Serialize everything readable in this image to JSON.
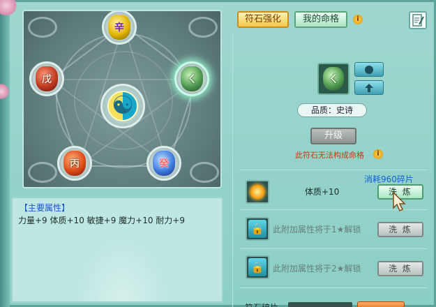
{
  "colors": {
    "accent_tab": "#f2c94c",
    "attr_title": "#1a55c8",
    "warning": "#d0360e",
    "cost": "#1260d6"
  },
  "star_map": {
    "nodes": [
      {
        "key": "top",
        "glyph": "辛",
        "icon": "xin-rune-gem"
      },
      {
        "key": "left",
        "glyph": "戊",
        "icon": "wu-rune-gem"
      },
      {
        "key": "right",
        "glyph": "ㄑ",
        "icon": "green-rune-gem",
        "selected": true
      },
      {
        "key": "bottom_left",
        "glyph": "丙",
        "icon": "bing-rune-gem"
      },
      {
        "key": "bottom_right",
        "glyph": "癸",
        "icon": "gui-rune-gem"
      }
    ],
    "center_icon": "yin-yang-icon"
  },
  "attributes": {
    "title": "【主要属性】",
    "values": "力量+9 体质+10 敏捷+9 魔力+10 耐力+9"
  },
  "tabs": [
    {
      "label": "符石强化",
      "active": true
    },
    {
      "label": "我的命格",
      "active": false
    }
  ],
  "detail": {
    "quality_label": "品质：史诗",
    "upgrade_label": "升级",
    "warning_text": "此符石无法构成命格",
    "cost_text": "消耗960碎片"
  },
  "refine_rows": [
    {
      "text": "体质+10",
      "button": "洗 炼",
      "locked": false
    },
    {
      "text": "此附加属性将于1★解锁",
      "button": "洗 炼",
      "locked": true
    },
    {
      "text": "此附加属性将于2★解锁",
      "button": "洗 炼",
      "locked": true
    }
  ],
  "bottom": {
    "label": "符石碎片"
  }
}
